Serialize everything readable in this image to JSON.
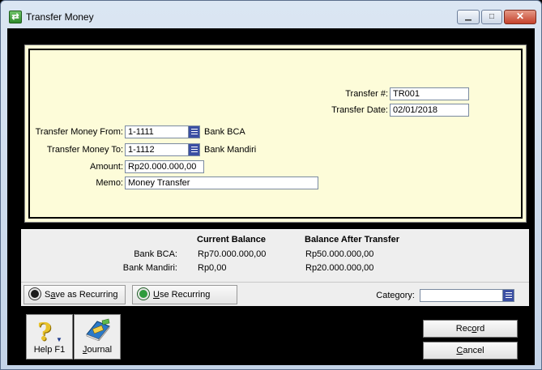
{
  "window": {
    "title": "Transfer Money",
    "min_glyph": "▁",
    "max_glyph": "□",
    "close_glyph": "✕"
  },
  "form": {
    "transfer_no_label": "Transfer #:",
    "transfer_no_value": "TR001",
    "transfer_date_label": "Transfer Date:",
    "transfer_date_value": "02/01/2018",
    "from_label": "Transfer Money From:",
    "from_value": "1-1111",
    "from_account_name": "Bank BCA",
    "to_label": "Transfer Money To:",
    "to_value": "1-1112",
    "to_account_name": "Bank Mandiri",
    "amount_label": "Amount:",
    "amount_value": "Rp20.000.000,00",
    "memo_label": "Memo:",
    "memo_value": "Money Transfer"
  },
  "balances": {
    "header_current": "Current Balance",
    "header_after": "Balance After Transfer",
    "rows": [
      {
        "label": "Bank BCA:",
        "current": "Rp70.000.000,00",
        "after": "Rp50.000.000,00"
      },
      {
        "label": "Bank Mandiri:",
        "current": "Rp0,00",
        "after": "Rp20.000.000,00"
      }
    ]
  },
  "toolbar": {
    "save_recurring_pre": "S",
    "save_recurring_key": "a",
    "save_recurring_post": "ve as Recurring",
    "use_recurring_key": "U",
    "use_recurring_post": "se Recurring",
    "category_label": "Category:",
    "category_value": ""
  },
  "bottom": {
    "help_label": "Help F1",
    "journal_key": "J",
    "journal_post": "ournal",
    "record_pre": "Rec",
    "record_key": "o",
    "record_post": "rd",
    "cancel_key": "C",
    "cancel_post": "ancel"
  },
  "icons": {
    "app": "transfer-money-app-icon",
    "help": "help-question-icon",
    "journal": "journal-book-icon",
    "dropdown": "list-dropdown-icon",
    "recurring_save": "save-recurring-icon",
    "recurring_use": "use-recurring-icon"
  }
}
